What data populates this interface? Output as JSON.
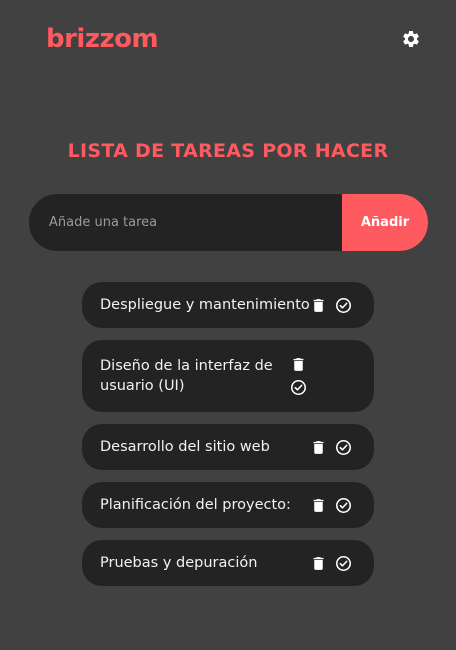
{
  "brand": {
    "logo": "brizzom",
    "accent": "#ff5a5f"
  },
  "header": {
    "settings_icon": "gear-icon"
  },
  "page": {
    "title": "LISTA DE TAREAS POR HACER"
  },
  "add_task": {
    "placeholder": "Añade una tarea",
    "value": "",
    "button_label": "Añadir"
  },
  "tasks": [
    {
      "label": "Despliegue y mantenimiento"
    },
    {
      "label": "Diseño de la interfaz de usuario (UI)"
    },
    {
      "label": "Desarrollo del sitio web"
    },
    {
      "label": "Planificación del proyecto:"
    },
    {
      "label": "Pruebas y depuración"
    }
  ],
  "icons": {
    "delete": "trash-icon",
    "complete": "check-circle-icon"
  }
}
